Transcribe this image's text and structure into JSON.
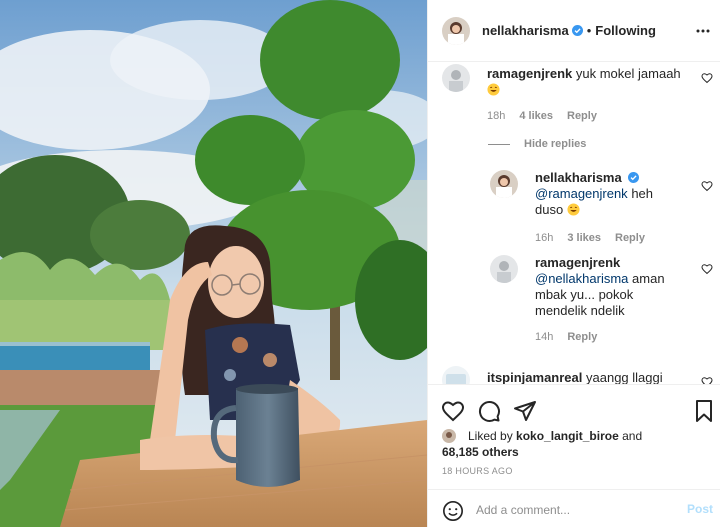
{
  "post": {
    "username": "nellakharisma",
    "follow_state": "Following",
    "separator": "•"
  },
  "comments": [
    {
      "username": "ramagenjrenk",
      "text": "yuk mokel jamaah",
      "emoji": "laughing-emoji",
      "time": "18h",
      "likes": "4 likes",
      "reply_label": "Reply"
    }
  ],
  "hide_replies_label": "Hide replies",
  "replies": [
    {
      "username": "nellakharisma",
      "verified": true,
      "mention": "@ramagenjrenk",
      "text": "heh",
      "text_line2": "duso",
      "emoji": "laughing-emoji",
      "time": "16h",
      "likes": "3 likes",
      "reply_label": "Reply"
    },
    {
      "username": "ramagenjrenk",
      "mention": "@nellakharisma",
      "text": "aman",
      "text_line2": "mbak yu... pokok",
      "text_line3": "mendelik ndelik",
      "time": "14h",
      "reply_label": "Reply"
    }
  ],
  "partial_comment": {
    "username": "itspinjamanreal",
    "text": "yaangg llaggi"
  },
  "liked_by": {
    "prefix": "Liked by",
    "user": "koko_langit_biroe",
    "connector": "and",
    "others": "68,185 others"
  },
  "timestamp": "18 HOURS AGO",
  "add_comment": {
    "placeholder": "Add a comment...",
    "post_label": "Post"
  },
  "colors": {
    "text": "#262626",
    "muted": "#8e8e8e",
    "verified": "#3897f0",
    "mention": "#00376b",
    "post_disabled": "#b2dffc",
    "border": "#efefef"
  },
  "icons": {
    "more": "more-horizontal-icon",
    "heart": "heart-icon",
    "comment": "comment-icon",
    "share": "share-icon",
    "save": "bookmark-icon",
    "emoji": "emoji-icon",
    "verified": "verified-badge-icon"
  }
}
